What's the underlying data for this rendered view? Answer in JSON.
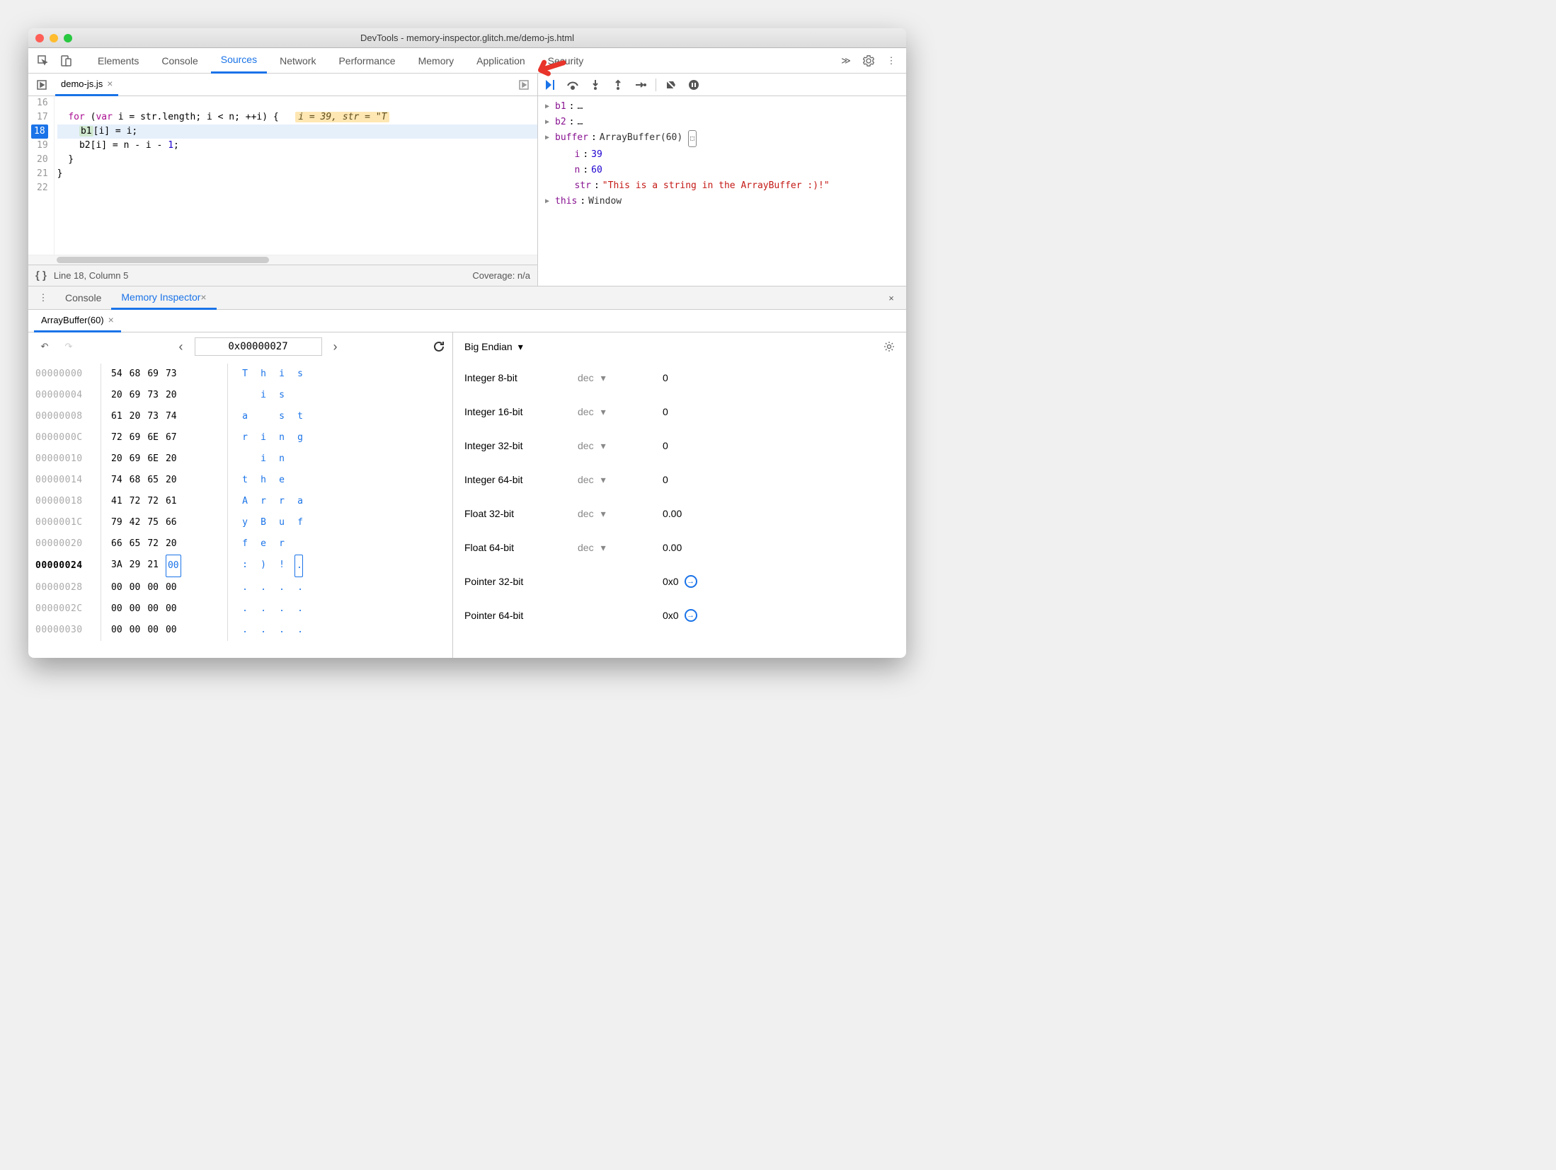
{
  "window": {
    "title": "DevTools - memory-inspector.glitch.me/demo-js.html"
  },
  "toolbarTabs": [
    "Elements",
    "Console",
    "Sources",
    "Network",
    "Performance",
    "Memory",
    "Application",
    "Security"
  ],
  "toolbarActive": "Sources",
  "fileTab": "demo-js.js",
  "code": {
    "lines": [
      {
        "n": 16,
        "t": ""
      },
      {
        "n": 17,
        "t": "for (var i = str.length; i < n; ++i) {",
        "hint": "i = 39, str = \"T"
      },
      {
        "n": 18,
        "t": "b1[i] = i;",
        "bp": true,
        "hl": true,
        "hlToken": "b1"
      },
      {
        "n": 19,
        "t": "b2[i] = n - i - 1;"
      },
      {
        "n": 20,
        "t": "}"
      },
      {
        "n": 21,
        "t": "}"
      },
      {
        "n": 22,
        "t": ""
      }
    ]
  },
  "status": {
    "pos": "Line 18, Column 5",
    "coverage": "Coverage: n/a"
  },
  "scope": [
    {
      "name": "b1",
      "value": "…",
      "expandable": true
    },
    {
      "name": "b2",
      "value": "…",
      "expandable": true
    },
    {
      "name": "buffer",
      "value": "ArrayBuffer(60)",
      "expandable": true,
      "chip": true
    },
    {
      "name": "i",
      "value": "39",
      "kind": "num"
    },
    {
      "name": "n",
      "value": "60",
      "kind": "num"
    },
    {
      "name": "str",
      "value": "\"This is a string in the ArrayBuffer :)!\"",
      "kind": "str"
    },
    {
      "name": "this",
      "value": "Window",
      "expandable": true
    }
  ],
  "drawerTabs": [
    "Console",
    "Memory Inspector"
  ],
  "drawerActive": "Memory Inspector",
  "memTab": "ArrayBuffer(60)",
  "hex": {
    "address": "0x00000027",
    "rows": [
      {
        "addr": "00000000",
        "bytes": [
          "54",
          "68",
          "69",
          "73"
        ],
        "ascii": [
          "T",
          "h",
          "i",
          "s"
        ]
      },
      {
        "addr": "00000004",
        "bytes": [
          "20",
          "69",
          "73",
          "20"
        ],
        "ascii": [
          " ",
          "i",
          "s",
          " "
        ]
      },
      {
        "addr": "00000008",
        "bytes": [
          "61",
          "20",
          "73",
          "74"
        ],
        "ascii": [
          "a",
          " ",
          "s",
          "t"
        ]
      },
      {
        "addr": "0000000C",
        "bytes": [
          "72",
          "69",
          "6E",
          "67"
        ],
        "ascii": [
          "r",
          "i",
          "n",
          "g"
        ]
      },
      {
        "addr": "00000010",
        "bytes": [
          "20",
          "69",
          "6E",
          "20"
        ],
        "ascii": [
          " ",
          "i",
          "n",
          " "
        ]
      },
      {
        "addr": "00000014",
        "bytes": [
          "74",
          "68",
          "65",
          "20"
        ],
        "ascii": [
          "t",
          "h",
          "e",
          " "
        ]
      },
      {
        "addr": "00000018",
        "bytes": [
          "41",
          "72",
          "72",
          "61"
        ],
        "ascii": [
          "A",
          "r",
          "r",
          "a"
        ]
      },
      {
        "addr": "0000001C",
        "bytes": [
          "79",
          "42",
          "75",
          "66"
        ],
        "ascii": [
          "y",
          "B",
          "u",
          "f"
        ]
      },
      {
        "addr": "00000020",
        "bytes": [
          "66",
          "65",
          "72",
          "20"
        ],
        "ascii": [
          "f",
          "e",
          "r",
          " "
        ]
      },
      {
        "addr": "00000024",
        "bytes": [
          "3A",
          "29",
          "21",
          "00"
        ],
        "ascii": [
          ":",
          ")",
          "!",
          "."
        ],
        "cur": true,
        "selIdx": 3
      },
      {
        "addr": "00000028",
        "bytes": [
          "00",
          "00",
          "00",
          "00"
        ],
        "ascii": [
          ".",
          ".",
          ".",
          "."
        ]
      },
      {
        "addr": "0000002C",
        "bytes": [
          "00",
          "00",
          "00",
          "00"
        ],
        "ascii": [
          ".",
          ".",
          ".",
          "."
        ]
      },
      {
        "addr": "00000030",
        "bytes": [
          "00",
          "00",
          "00",
          "00"
        ],
        "ascii": [
          ".",
          ".",
          ".",
          "."
        ]
      }
    ]
  },
  "interp": {
    "endian": "Big Endian",
    "rows": [
      {
        "type": "Integer 8-bit",
        "fmt": "dec",
        "val": "0"
      },
      {
        "type": "Integer 16-bit",
        "fmt": "dec",
        "val": "0"
      },
      {
        "type": "Integer 32-bit",
        "fmt": "dec",
        "val": "0"
      },
      {
        "type": "Integer 64-bit",
        "fmt": "dec",
        "val": "0"
      },
      {
        "type": "Float 32-bit",
        "fmt": "dec",
        "val": "0.00"
      },
      {
        "type": "Float 64-bit",
        "fmt": "dec",
        "val": "0.00"
      },
      {
        "type": "Pointer 32-bit",
        "fmt": "",
        "val": "0x0",
        "jump": true
      },
      {
        "type": "Pointer 64-bit",
        "fmt": "",
        "val": "0x0",
        "jump": true
      }
    ]
  }
}
